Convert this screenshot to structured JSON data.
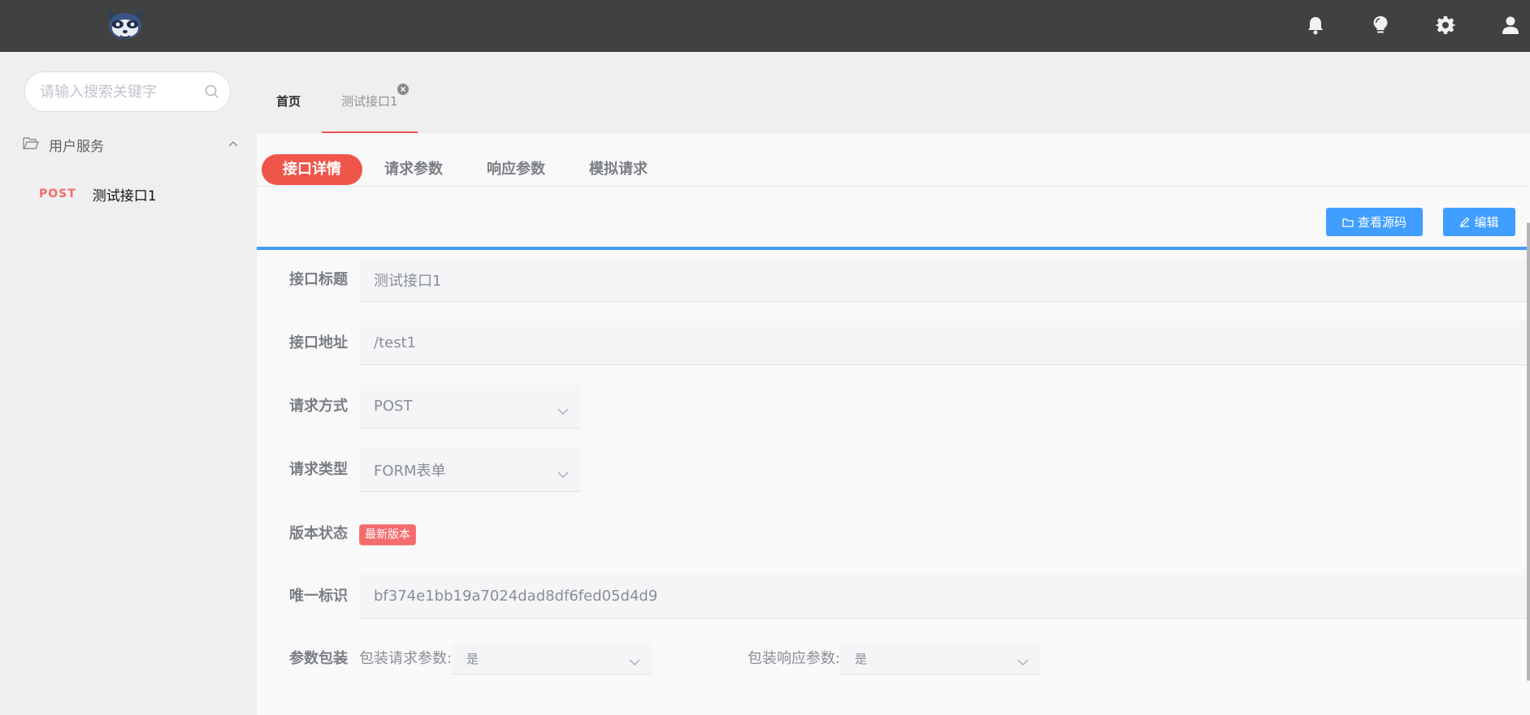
{
  "header": {
    "logo": "raccoon-logo",
    "icons": [
      "bell-icon",
      "lightbulb-icon",
      "gear-icon",
      "user-icon"
    ]
  },
  "sidebar": {
    "search_placeholder": "请输入搜索关键字",
    "group": {
      "label": "用户服务",
      "expanded": true
    },
    "items": [
      {
        "method": "POST",
        "label": "测试接口1"
      }
    ]
  },
  "page_tabs": [
    {
      "label": "首页",
      "active": false
    },
    {
      "label": "测试接口1",
      "active": true,
      "closable": true
    }
  ],
  "subtabs": [
    {
      "label": "接口详情",
      "active": true
    },
    {
      "label": "请求参数",
      "active": false
    },
    {
      "label": "响应参数",
      "active": false
    },
    {
      "label": "模拟请求",
      "active": false
    }
  ],
  "actions": {
    "view_source": "查看源码",
    "edit": "编辑"
  },
  "form": {
    "title": {
      "label": "接口标题",
      "value": "测试接口1"
    },
    "address": {
      "label": "接口地址",
      "value": "/test1"
    },
    "method": {
      "label": "请求方式",
      "value": "POST"
    },
    "type": {
      "label": "请求类型",
      "value": "FORM表单"
    },
    "version": {
      "label": "版本状态",
      "badge": "最新版本"
    },
    "uid": {
      "label": "唯一标识",
      "value": "bf374e1bb19a7024dad8df6fed05d4d9"
    },
    "wrap": {
      "label": "参数包装",
      "request_label": "包装请求参数:",
      "request_value": "是",
      "response_label": "包装响应参数:",
      "response_value": "是"
    }
  },
  "colors": {
    "topbar": "#414141",
    "accent_red": "#f0554a",
    "primary_blue": "#409eff",
    "method_red": "#f56c6c"
  }
}
